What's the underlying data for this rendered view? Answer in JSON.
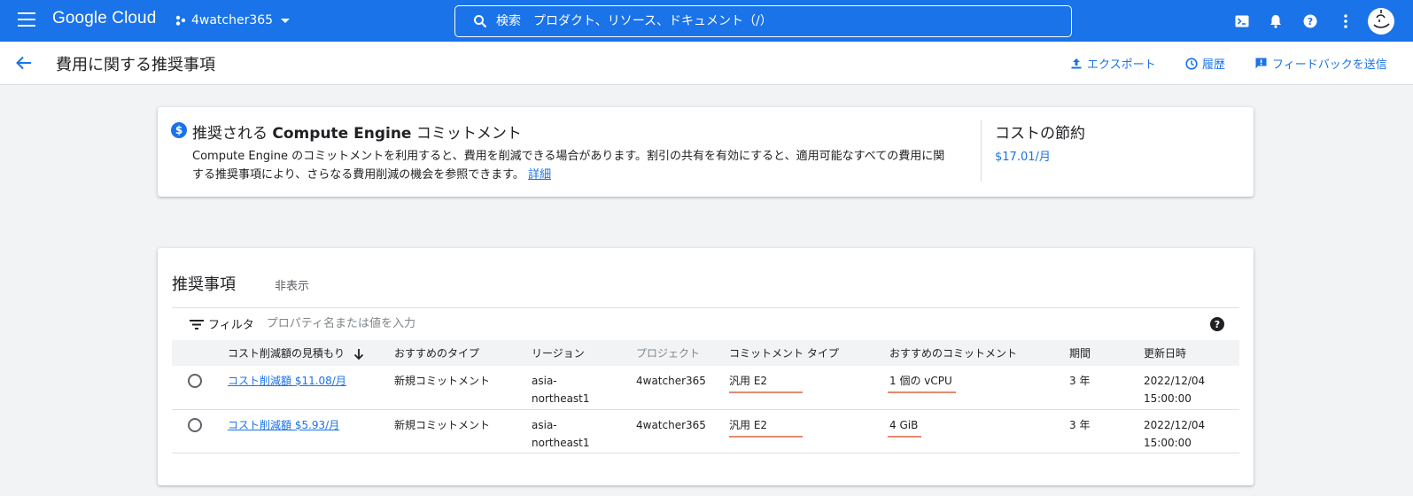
{
  "header": {
    "logo": "Google Cloud",
    "project": "4watcher365",
    "search_placeholder": "検索　プロダクト、リソース、ドキュメント（/）",
    "icons": [
      "menu-icon",
      "project-icon",
      "search-icon",
      "terminal-icon",
      "bell-icon",
      "help-icon",
      "more-vert-icon",
      "avatar"
    ]
  },
  "subheader": {
    "title": "費用に関する推奨事項",
    "export": "エクスポート",
    "history": "履歴",
    "feedback": "フィードバックを送信"
  },
  "summary": {
    "title_pre": "推奨される ",
    "title_bold": "Compute Engine",
    "title_post": " コミットメント",
    "description": "Compute Engine のコミットメントを利用すると、費用を削減できる場合があります。割引の共有を有効にすると、適用可能なすべての費用に関する推奨事項により、さらなる費用削減の機会を参照できます。",
    "details_link": "詳細",
    "savings_label": "コストの節約",
    "savings_value": "$17.01/月"
  },
  "recommendations": {
    "title": "推奨事項",
    "hide": "非表示",
    "filter_label": "フィルタ",
    "filter_placeholder": "プロパティ名または値を入力",
    "columns": [
      "コスト削減額の見積もり",
      "おすすめのタイプ",
      "リージョン",
      "プロジェクト",
      "コミットメント タイプ",
      "おすすめのコミットメント",
      "期間",
      "更新日時"
    ],
    "rows": [
      {
        "savings": "コスト削減額 $11.08/月",
        "type": "新規コミットメント",
        "region_1": "asia-",
        "region_2": "northeast1",
        "project": "4watcher365",
        "commit_type": "汎用 E2",
        "commitment": "1 個の vCPU",
        "term": "3 年",
        "updated_1": "2022/12/04",
        "updated_2": "15:00:00"
      },
      {
        "savings": "コスト削減額 $5.93/月",
        "type": "新規コミットメント",
        "region_1": "asia-",
        "region_2": "northeast1",
        "project": "4watcher365",
        "commit_type": "汎用 E2",
        "commitment": "4 GiB",
        "term": "3 年",
        "updated_1": "2022/12/04",
        "updated_2": "15:00:00"
      }
    ]
  },
  "colors": {
    "brand": "#1a73e8",
    "highlight_underline": "#e28a73"
  }
}
